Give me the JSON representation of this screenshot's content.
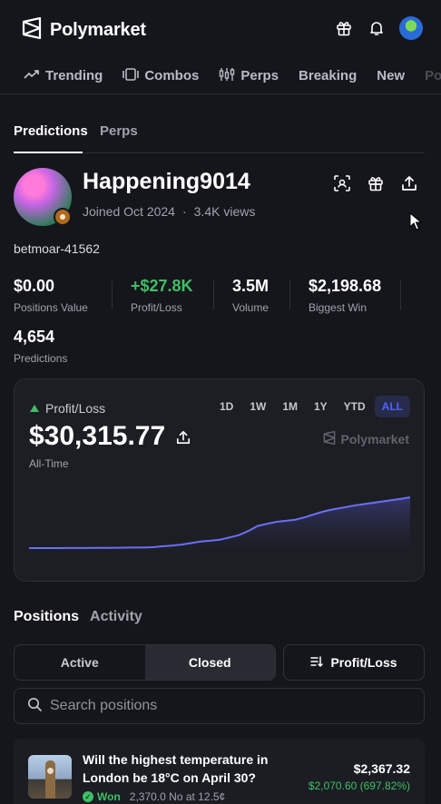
{
  "brand": {
    "name": "Polymarket"
  },
  "nav": {
    "categories": [
      "Trending",
      "Combos",
      "Perps",
      "Breaking",
      "New",
      "Po"
    ]
  },
  "profile_tabs": [
    "Predictions",
    "Perps"
  ],
  "profile": {
    "username": "Happening9014",
    "joined": "Joined Oct 2024",
    "views": "3.4K views",
    "handle": "betmoar-41562"
  },
  "stats": [
    {
      "value": "$0.00",
      "label": "Positions Value"
    },
    {
      "value": "+$27.8K",
      "label": "Profit/Loss"
    },
    {
      "value": "3.5M",
      "label": "Volume"
    },
    {
      "value": "$2,198.68",
      "label": "Biggest Win"
    }
  ],
  "predictions": {
    "value": "4,654",
    "label": "Predictions"
  },
  "profit_loss": {
    "label": "Profit/Loss",
    "value": "$30,315.77",
    "period": "All-Time",
    "ranges": [
      "1D",
      "1W",
      "1M",
      "1Y",
      "YTD",
      "ALL"
    ],
    "active_range": "ALL",
    "watermark": "Polymarket"
  },
  "chart_data": {
    "type": "area",
    "x": [
      0,
      1,
      2,
      3,
      4,
      5,
      6,
      7,
      8,
      9,
      10,
      11,
      12,
      13,
      14,
      15,
      16,
      17,
      18,
      19,
      20,
      21,
      22,
      23,
      24,
      25,
      26,
      27,
      28,
      29,
      30,
      31,
      32,
      33,
      34,
      35,
      36,
      37,
      38,
      39,
      40
    ],
    "values": [
      0,
      0,
      10,
      20,
      30,
      50,
      80,
      100,
      150,
      200,
      260,
      300,
      350,
      550,
      1100,
      1500,
      2100,
      3000,
      3900,
      4400,
      5000,
      6300,
      7700,
      10200,
      13200,
      14500,
      15700,
      16300,
      17000,
      18500,
      20300,
      22000,
      23200,
      24200,
      25300,
      26100,
      26900,
      27700,
      28600,
      29400,
      30315.77
    ],
    "title": "",
    "xlabel": "",
    "ylabel": "",
    "line_color": "#6b6ff5",
    "fill_color": "#3a3a78"
  },
  "positions": {
    "tabs": [
      "Positions",
      "Activity"
    ],
    "filters": {
      "active": "Active",
      "closed": "Closed",
      "selected": "Closed"
    },
    "sort_label": "Profit/Loss",
    "search_placeholder": "Search positions",
    "rows": [
      {
        "title": "Will the highest temperature in London be 18°C on April 30?",
        "status": "Won",
        "detail": "2,370.0 No at 12.5¢",
        "value": "$2,367.32",
        "gain": "$2,070.60 (697.82%)"
      }
    ]
  },
  "colors": {
    "background": "#15161b",
    "accent": "#4f63ff",
    "positive": "#3fbf66"
  }
}
